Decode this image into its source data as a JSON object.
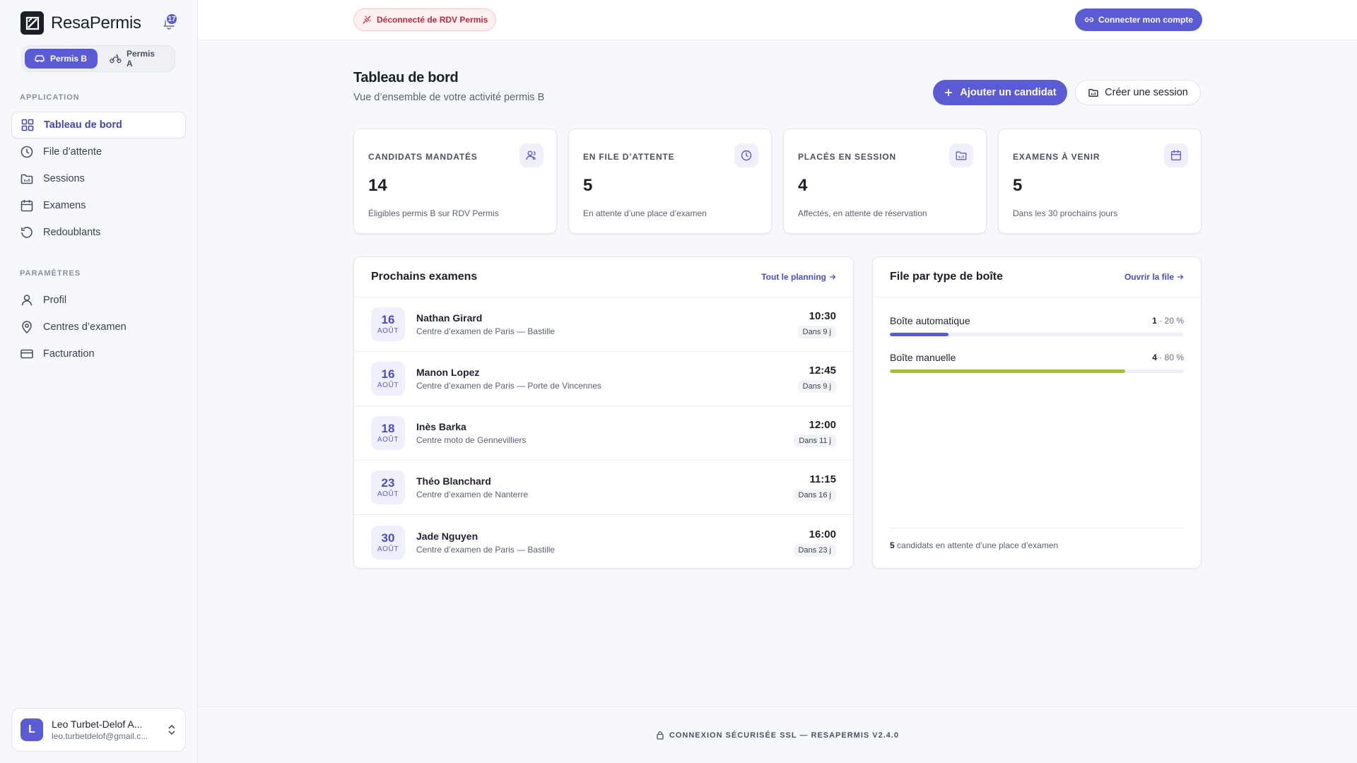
{
  "brand": {
    "name": "ResaPermis",
    "notifications": "17"
  },
  "permis_switch": {
    "items": [
      {
        "label": "Permis B",
        "active": true
      },
      {
        "label": "Permis A",
        "active": false
      }
    ]
  },
  "nav": {
    "application_title": "APPLICATION",
    "application_items": [
      {
        "label": "Tableau de bord",
        "icon": "grid-icon",
        "active": true
      },
      {
        "label": "File d’attente",
        "icon": "clock-icon"
      },
      {
        "label": "Sessions",
        "icon": "folder-icon"
      },
      {
        "label": "Examens",
        "icon": "calendar-icon"
      },
      {
        "label": "Redoublants",
        "icon": "rotate-icon"
      }
    ],
    "params_title": "PARAMÈTRES",
    "params_items": [
      {
        "label": "Profil",
        "icon": "user-icon"
      },
      {
        "label": "Centres d’examen",
        "icon": "map-pin-icon"
      },
      {
        "label": "Facturation",
        "icon": "credit-card-icon"
      }
    ]
  },
  "user": {
    "initial": "L",
    "name": "Leo Turbet-Delof A...",
    "email": "leo.turbetdelof@gmail.c..."
  },
  "topbar": {
    "status": "Déconnecté de RDV Permis",
    "connect": "Connecter mon compte"
  },
  "page": {
    "title": "Tableau de bord",
    "subtitle": "Vue d’ensemble de votre activité permis B",
    "add_candidate": "Ajouter un candidat",
    "create_session": "Créer une session"
  },
  "stats": [
    {
      "label": "CANDIDATS MANDATÉS",
      "value": "14",
      "desc": "Éligibles permis B sur RDV Permis",
      "icon": "users-icon"
    },
    {
      "label": "EN FILE D’ATTENTE",
      "value": "5",
      "desc": "En attente d’une place d’examen",
      "icon": "clock-icon"
    },
    {
      "label": "PLACÉS EN SESSION",
      "value": "4",
      "desc": "Affectés, en attente de réservation",
      "icon": "folder-icon"
    },
    {
      "label": "EXAMENS À VENIR",
      "value": "5",
      "desc": "Dans les 30 prochains jours",
      "icon": "calendar-icon"
    }
  ],
  "exams_panel": {
    "title": "Prochains examens",
    "link": "Tout le planning",
    "rows": [
      {
        "day": "16",
        "month": "AOÛT",
        "name": "Nathan Girard",
        "center": "Centre d’examen de Paris — Bastille",
        "time": "10:30",
        "badge": "Dans 9 j"
      },
      {
        "day": "16",
        "month": "AOÛT",
        "name": "Manon Lopez",
        "center": "Centre d’examen de Paris — Porte de Vincennes",
        "time": "12:45",
        "badge": "Dans 9 j"
      },
      {
        "day": "18",
        "month": "AOÛT",
        "name": "Inès Barka",
        "center": "Centre moto de Gennevilliers",
        "time": "12:00",
        "badge": "Dans 11 j"
      },
      {
        "day": "23",
        "month": "AOÛT",
        "name": "Théo Blanchard",
        "center": "Centre d’examen de Nanterre",
        "time": "11:15",
        "badge": "Dans 16 j"
      },
      {
        "day": "30",
        "month": "AOÛT",
        "name": "Jade Nguyen",
        "center": "Centre d’examen de Paris — Bastille",
        "time": "16:00",
        "badge": "Dans 23 j"
      }
    ]
  },
  "gearbox_panel": {
    "title": "File par type de boîte",
    "link": "Ouvrir la file",
    "rows": [
      {
        "label": "Boîte automatique",
        "count": "1",
        "percent_text": " · 20 %",
        "fraction": 0.2,
        "color": "#5b5bd6"
      },
      {
        "label": "Boîte manuelle",
        "count": "4",
        "percent_text": " · 80 %",
        "fraction": 0.8,
        "color": "#a8bf2e"
      }
    ],
    "footer_count": "5",
    "footer_text": " candidats en attente d’une place d’examen"
  },
  "footer": {
    "text": "CONNEXION SÉCURISÉE SSL — RESAPERMIS V2.4.0"
  },
  "colors": {
    "accent": "#5b5bd6",
    "danger": "#c0283a"
  }
}
